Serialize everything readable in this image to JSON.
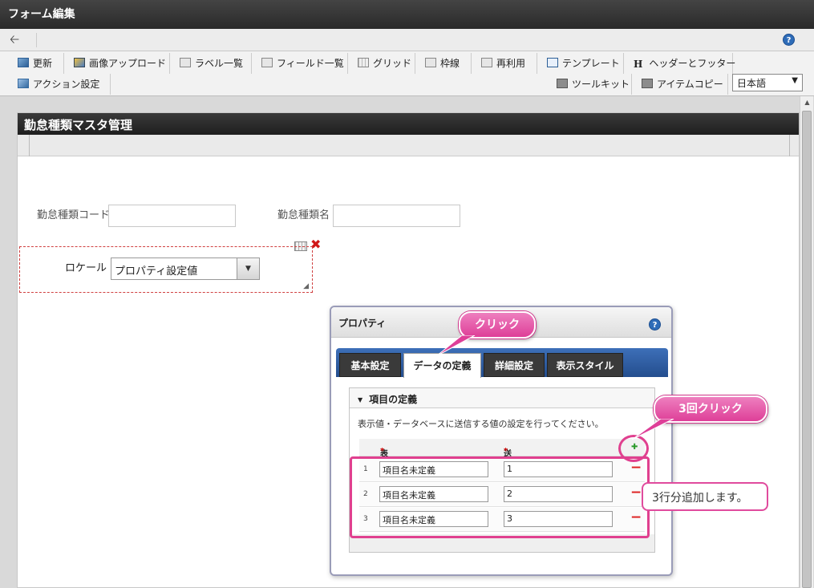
{
  "window": {
    "title": "フォーム編集"
  },
  "nav": {
    "back_icon": "back-arrow-icon",
    "help": "?"
  },
  "toolbar": {
    "row1": [
      "更新",
      "画像アップロード",
      "ラベル一覧",
      "フィールド一覧",
      "グリッド",
      "枠線",
      "再利用",
      "テンプレート",
      "ヘッダーとフッター"
    ],
    "row2_left": "アクション設定",
    "toolkit": "ツールキット",
    "item_copy": "アイテムコピー",
    "header_icon_glyph": "H",
    "language": "日本語",
    "language_arrow": "▼"
  },
  "form": {
    "title": "勤怠種類マスタ管理",
    "field_code_label": "勤怠種類コード",
    "field_name_label": "勤怠種類名",
    "locale_label": "ロケール",
    "locale_value": "プロパティ設定値",
    "delete_glyph": "✖",
    "resize_glyph": "◢",
    "dropdown_arrow": "▼"
  },
  "panel": {
    "title": "プロパティ",
    "help": "?",
    "tabs": [
      "基本設定",
      "データの定義",
      "詳細設定",
      "表示スタイル"
    ],
    "active_tab": "データの定義",
    "section_title": "項目の定義",
    "section_arrow": "▼",
    "description": "表示値・データベースに送信する値の設定を行ってください。",
    "col_display": "表示値",
    "col_send": "送信値",
    "required_mark": "*",
    "add_glyph": "✚",
    "remove_glyph": "−",
    "rows": [
      {
        "num": "1",
        "display": "項目名未定義",
        "send": "1"
      },
      {
        "num": "2",
        "display": "項目名未定義",
        "send": "2"
      },
      {
        "num": "3",
        "display": "項目名未定義",
        "send": "3"
      }
    ]
  },
  "annotations": {
    "click": "クリック",
    "click3": "3回クリック",
    "note": "3行分追加します。"
  },
  "colors": {
    "accent": "#de3f98",
    "tab_bar": "#2d5f9f",
    "header": "#2a2a2a"
  }
}
